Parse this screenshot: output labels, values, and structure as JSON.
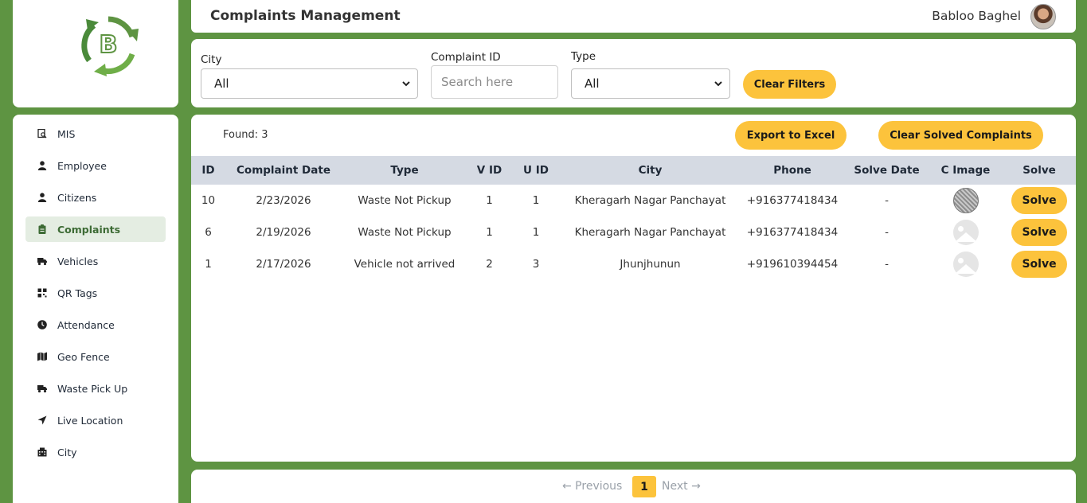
{
  "header": {
    "title": "Complaints Management",
    "user_name": "Babloo Baghel"
  },
  "brand": {
    "logo_letter": "B",
    "accent": "#5e9442",
    "button_color": "#fcc33c"
  },
  "sidebar": {
    "items": [
      {
        "label": "MIS",
        "icon": "report-search-icon",
        "active": false
      },
      {
        "label": "Employee",
        "icon": "user-icon",
        "active": false
      },
      {
        "label": "Citizens",
        "icon": "user-icon",
        "active": false
      },
      {
        "label": "Complaints",
        "icon": "clipboard-icon",
        "active": true
      },
      {
        "label": "Vehicles",
        "icon": "truck-icon",
        "active": false
      },
      {
        "label": "QR Tags",
        "icon": "qr-code-icon",
        "active": false
      },
      {
        "label": "Attendance",
        "icon": "clock-icon",
        "active": false
      },
      {
        "label": "Geo Fence",
        "icon": "map-icon",
        "active": false
      },
      {
        "label": "Waste Pick Up",
        "icon": "truck-icon",
        "active": false
      },
      {
        "label": "Live Location",
        "icon": "location-arrow-icon",
        "active": false
      },
      {
        "label": "City",
        "icon": "building-icon",
        "active": false
      }
    ]
  },
  "filters": {
    "city_label": "City",
    "city_value": "All",
    "complaint_id_label": "Complaint ID",
    "complaint_id_placeholder": "Search here",
    "type_label": "Type",
    "type_value": "All",
    "clear_filters": "Clear Filters"
  },
  "table_panel": {
    "found": "Found: 3",
    "export_label": "Export to Excel",
    "clear_solved_label": "Clear Solved Complaints",
    "columns": [
      "ID",
      "Complaint Date",
      "Type",
      "V ID",
      "U ID",
      "City",
      "Phone",
      "Solve Date",
      "C Image",
      "Solve"
    ],
    "rows": [
      {
        "id": "10",
        "date": "2/23/2026",
        "type": "Waste Not Pickup",
        "vid": "1",
        "uid": "1",
        "city": "Kheragarh Nagar Panchayat",
        "phone": "+916377418434",
        "solve_date": "-",
        "image": "photo",
        "solve": "Solve"
      },
      {
        "id": "6",
        "date": "2/19/2026",
        "type": "Waste Not Pickup",
        "vid": "1",
        "uid": "1",
        "city": "Kheragarh Nagar Panchayat",
        "phone": "+916377418434",
        "solve_date": "-",
        "image": "placeholder",
        "solve": "Solve"
      },
      {
        "id": "1",
        "date": "2/17/2026",
        "type": "Vehicle not arrived",
        "vid": "2",
        "uid": "3",
        "city": "Jhunjhunun",
        "phone": "+919610394454",
        "solve_date": "-",
        "image": "placeholder",
        "solve": "Solve"
      }
    ]
  },
  "pagination": {
    "previous": "← Previous",
    "current": "1",
    "next": "Next →"
  }
}
